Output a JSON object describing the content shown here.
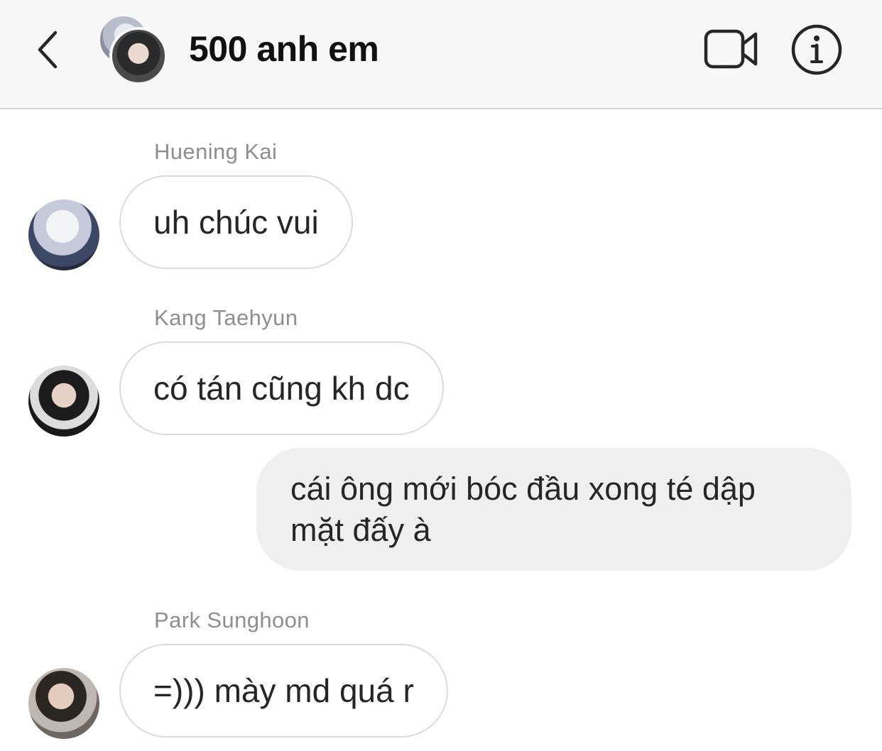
{
  "header": {
    "title": "500 anh em",
    "back_icon": "chevron-left-icon",
    "video_icon": "video-camera-icon",
    "info_icon": "info-icon"
  },
  "messages": [
    {
      "sender": "Huening Kai",
      "text": "uh chúc vui",
      "direction": "incoming"
    },
    {
      "sender": "Kang Taehyun",
      "text": "có tán cũng kh dc",
      "direction": "incoming"
    },
    {
      "sender": "",
      "text_line1": "cái ông mới bóc đầu xong té dập",
      "text_line2": "mặt đấy à",
      "direction": "outgoing"
    },
    {
      "sender": "Park Sunghoon",
      "text": "=))) mày md quá r",
      "direction": "incoming"
    }
  ],
  "colors": {
    "header_bg": "#f7f7f7",
    "incoming_border": "#dbdbdb",
    "outgoing_bg": "#efefef",
    "sender_name": "#8e8e8e"
  }
}
